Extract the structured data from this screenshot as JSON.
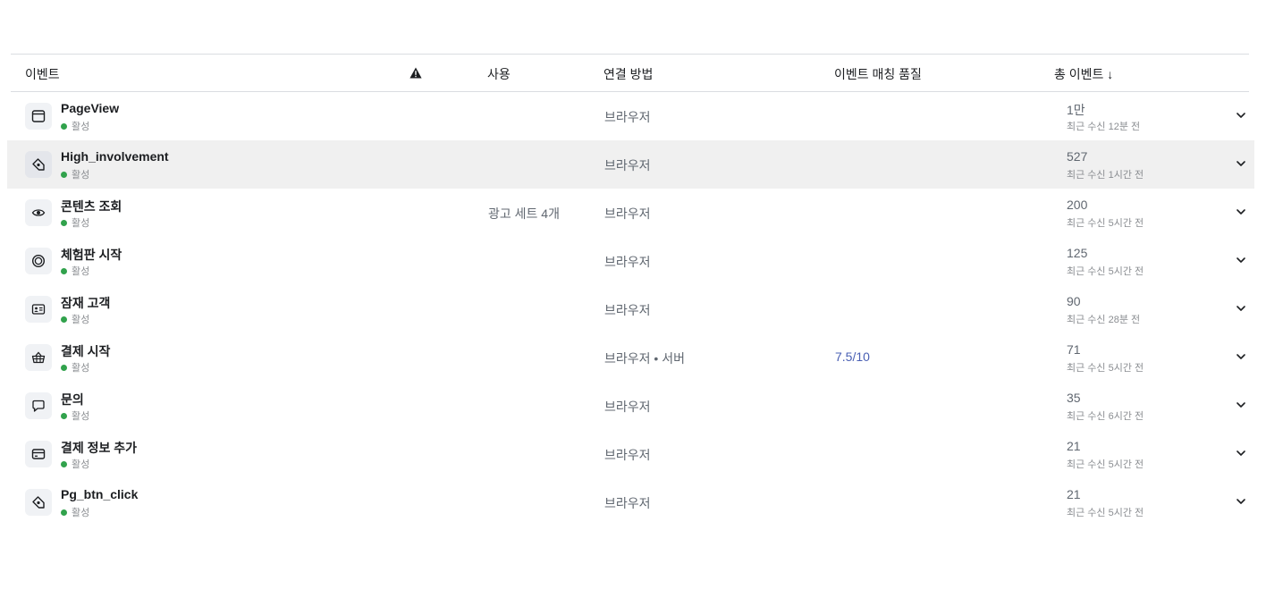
{
  "header": {
    "event": "이벤트",
    "usage": "사용",
    "connection": "연결 방법",
    "quality": "이벤트 매칭 품질",
    "total": "총 이벤트 ↓"
  },
  "colors": {
    "active": "#31a24c",
    "quality": "#4a60b4",
    "highlight": "#f0f0f0"
  },
  "rows": [
    {
      "icon": "browser-window-icon",
      "name": "PageView",
      "status": "활성",
      "usage": "",
      "connection": "브라우저",
      "quality": "",
      "total": "1만",
      "received": "최근 수신 12분 전"
    },
    {
      "icon": "tag-icon",
      "name": "High_involvement",
      "status": "활성",
      "usage": "",
      "connection": "브라우저",
      "quality": "",
      "total": "527",
      "received": "최근 수신 1시간 전",
      "highlighted": true
    },
    {
      "icon": "eye-icon",
      "name": "콘텐츠 조회",
      "status": "활성",
      "usage": "광고 세트 4개",
      "connection": "브라우저",
      "quality": "",
      "total": "200",
      "received": "최근 수신 5시간 전"
    },
    {
      "icon": "clock-icon",
      "name": "체험판 시작",
      "status": "활성",
      "usage": "",
      "connection": "브라우저",
      "quality": "",
      "total": "125",
      "received": "최근 수신 5시간 전"
    },
    {
      "icon": "id-card-icon",
      "name": "잠재 고객",
      "status": "활성",
      "usage": "",
      "connection": "브라우저",
      "quality": "",
      "total": "90",
      "received": "최근 수신 28분 전"
    },
    {
      "icon": "basket-icon",
      "name": "결제 시작",
      "status": "활성",
      "usage": "",
      "connection": "브라우저 • 서버",
      "quality": "7.5/10",
      "total": "71",
      "received": "최근 수신 5시간 전"
    },
    {
      "icon": "chat-bubble-icon",
      "name": "문의",
      "status": "활성",
      "usage": "",
      "connection": "브라우저",
      "quality": "",
      "total": "35",
      "received": "최근 수신 6시간 전"
    },
    {
      "icon": "credit-card-icon",
      "name": "결제 정보 추가",
      "status": "활성",
      "usage": "",
      "connection": "브라우저",
      "quality": "",
      "total": "21",
      "received": "최근 수신 5시간 전"
    },
    {
      "icon": "tag-icon",
      "name": "Pg_btn_click",
      "status": "활성",
      "usage": "",
      "connection": "브라우저",
      "quality": "",
      "total": "21",
      "received": "최근 수신 5시간 전"
    }
  ]
}
